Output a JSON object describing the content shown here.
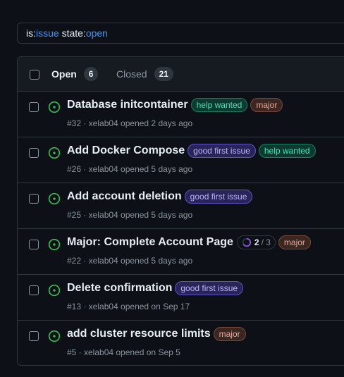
{
  "search": {
    "tokens": [
      {
        "key": "is:",
        "value": "issue"
      },
      {
        "key": " state:",
        "value": "open"
      }
    ]
  },
  "tabs": {
    "open": {
      "label": "Open",
      "count": "6"
    },
    "closed": {
      "label": "Closed",
      "count": "21"
    }
  },
  "colors": {
    "open_icon": "#3fb950",
    "accent": "#4493f8",
    "background": "#0d1117",
    "border": "#30363d"
  },
  "issues": [
    {
      "title": "Database initcontainer",
      "labels": [
        "help wanted",
        "major"
      ],
      "meta": "#32 · xelab04 opened 2 days ago"
    },
    {
      "title": "Add Docker Compose",
      "labels": [
        "good first issue",
        "help wanted"
      ],
      "meta": "#26 · xelab04 opened 5 days ago"
    },
    {
      "title": "Add account deletion",
      "labels": [
        "good first issue"
      ],
      "meta": "#25 · xelab04 opened 5 days ago"
    },
    {
      "title": "Major: Complete Account Page",
      "progress": {
        "done": "2",
        "total": "/ 3",
        "fraction": 0.667
      },
      "labels": [
        "major"
      ],
      "meta": "#22 · xelab04 opened 5 days ago"
    },
    {
      "title": "Delete confirmation",
      "labels": [
        "good first issue"
      ],
      "meta": "#13 · xelab04 opened on Sep 17"
    },
    {
      "title": "add cluster resource limits",
      "labels": [
        "major"
      ],
      "meta": "#5 · xelab04 opened on Sep 5"
    }
  ]
}
